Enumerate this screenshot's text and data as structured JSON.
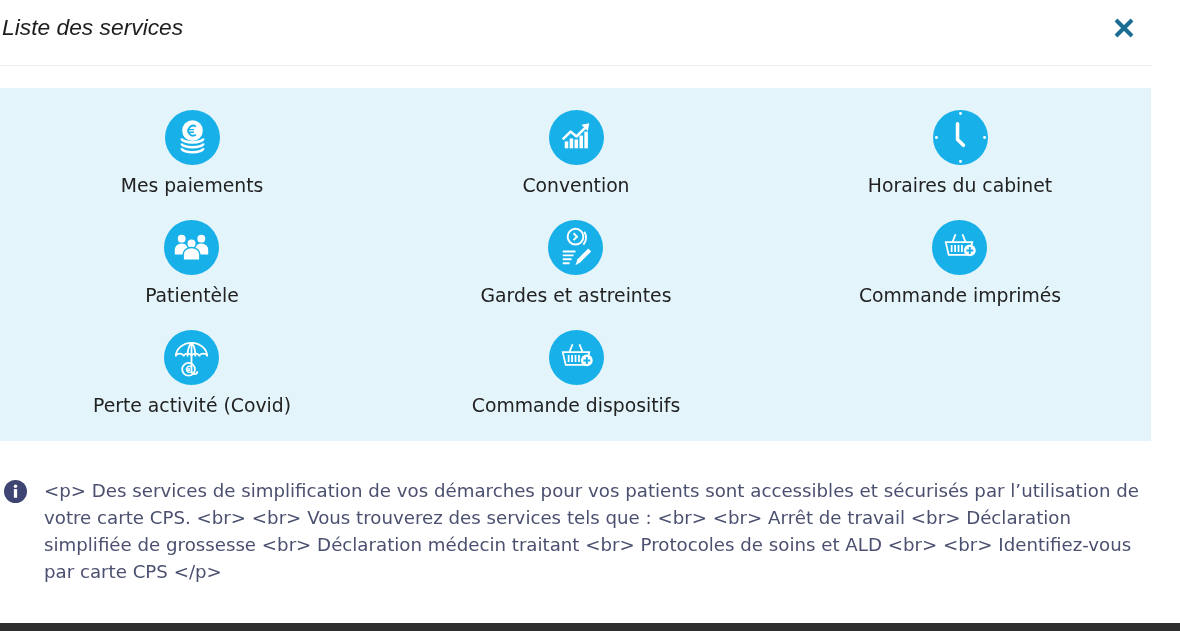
{
  "dialog": {
    "title": "Liste des services"
  },
  "services": [
    {
      "label": "Mes paiements"
    },
    {
      "label": "Convention"
    },
    {
      "label": "Horaires du cabinet"
    },
    {
      "label": "Patientèle"
    },
    {
      "label": "Gardes et astreintes"
    },
    {
      "label": "Commande imprimés"
    },
    {
      "label": "Perte activité (Covid)"
    },
    {
      "label": "Commande dispositifs"
    }
  ],
  "info": {
    "text": "<p> Des services de simplification de vos démarches pour vos patients sont accessibles et sécurisés par l’utilisation de votre carte CPS. <br> <br> Vous trouverez des services tels que : <br> <br> Arrêt de travail <br> Déclaration simplifiée de grossesse <br> Déclaration médecin traitant <br> Protocoles de soins et ALD <br> <br> Identifiez-vous par carte CPS </p>"
  }
}
